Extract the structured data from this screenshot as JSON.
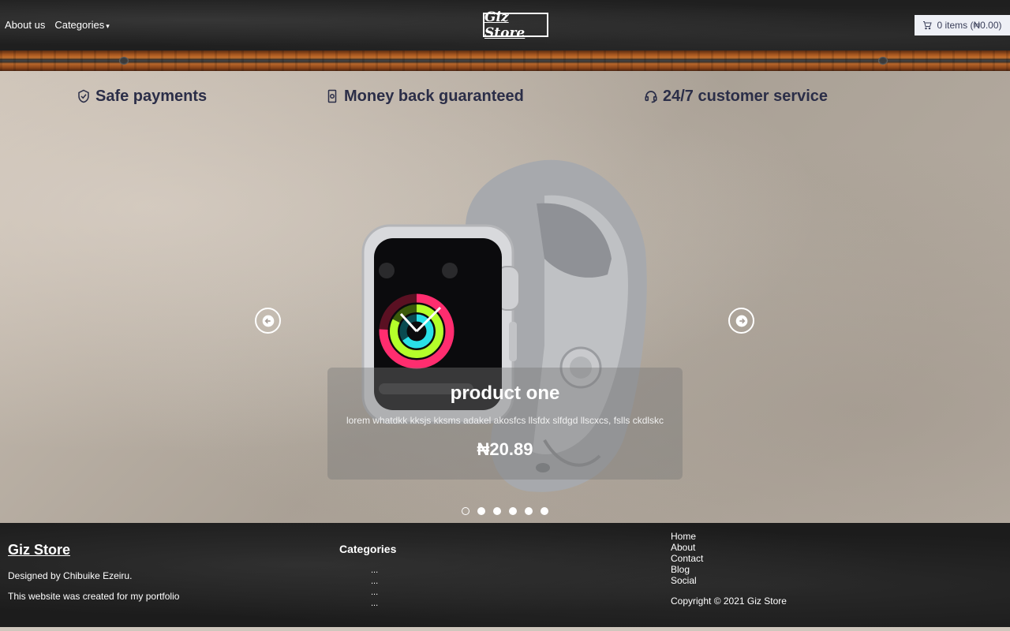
{
  "header": {
    "nav": {
      "about": "About us",
      "categories": "Categories"
    },
    "logo": "Giz Store",
    "cart": "0 items (₦0.00)"
  },
  "features": [
    {
      "label": "Safe payments",
      "icon": "shield-icon"
    },
    {
      "label": "Money back guaranteed",
      "icon": "money-icon"
    },
    {
      "label": "24/7 customer service",
      "icon": "headset-icon"
    }
  ],
  "slide": {
    "title": "product one",
    "description": "lorem whatdkk kksjs kksms adakel akosfcs llsfdx slfdgd llscxcs, fslls ckdlskc",
    "price": "₦20.89",
    "image": "smartwatch-image",
    "active_index": 0,
    "total": 6
  },
  "footer": {
    "brand": "Giz Store",
    "designed_by": "Designed by Chibuike Ezeiru.",
    "note": "This website was created for my portfolio",
    "categories_heading": "Categories",
    "categories": [
      "...",
      "...",
      "...",
      "..."
    ],
    "links": [
      "Home",
      "About",
      "Contact",
      "Blog",
      "Social"
    ],
    "copyright": "Copyright © 2021 Giz Store"
  },
  "colors": {
    "heading_text": "#2b2e48",
    "cart_bg": "#eef0f6"
  }
}
